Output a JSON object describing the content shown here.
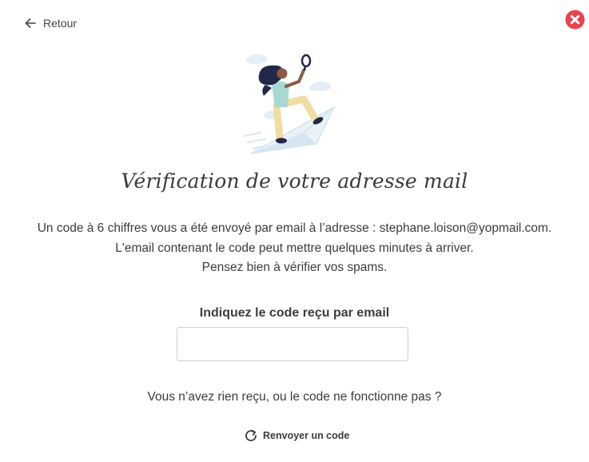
{
  "header": {
    "back_label": "Retour",
    "back_icon": "arrow-left-icon",
    "close_icon": "close-icon",
    "close_color": "#e8434f"
  },
  "illustration": {
    "icon": "woman-with-magnifier-on-paper-plane-illustration"
  },
  "main": {
    "title": "Vérification de votre adresse mail",
    "info_lines": [
      "Un code à 6 chiffres vous a été envoyé par email à l’adresse : stephane.loison@yopmail.com.",
      "L'email contenant le code peut mettre quelques minutes à arriver.",
      "Pensez bien à vérifier vos spams."
    ],
    "code_label": "Indiquez le code reçu par email",
    "code_value": "",
    "code_placeholder": "",
    "no_code_text": "Vous n’avez rien reçu, ou le code ne fonctionne pas ?",
    "resend_label": "Renvoyer un code",
    "resend_icon": "refresh-icon"
  }
}
